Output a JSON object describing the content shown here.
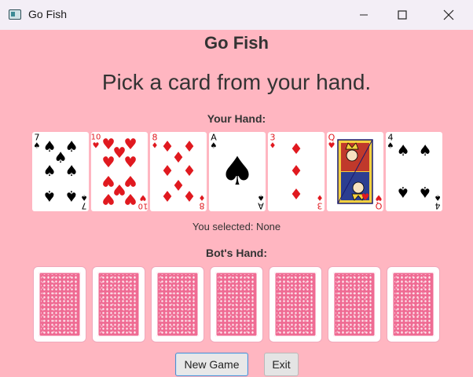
{
  "window": {
    "title": "Go Fish",
    "icon": "app-window-icon"
  },
  "game": {
    "title": "Go Fish",
    "prompt": "Pick a card from your hand.",
    "your_hand_label": "Your Hand:",
    "selected_text": "You selected: None",
    "bot_hand_label": "Bot's Hand:"
  },
  "player_hand": [
    {
      "rank": "7",
      "suit": "spades",
      "symbol": "♠",
      "color": "#000000"
    },
    {
      "rank": "10",
      "suit": "hearts",
      "symbol": "♥",
      "color": "#e0191f"
    },
    {
      "rank": "8",
      "suit": "diamonds",
      "symbol": "♦",
      "color": "#e0191f"
    },
    {
      "rank": "A",
      "suit": "spades",
      "symbol": "♠",
      "color": "#000000"
    },
    {
      "rank": "3",
      "suit": "diamonds",
      "symbol": "♦",
      "color": "#e0191f"
    },
    {
      "rank": "Q",
      "suit": "hearts",
      "symbol": "♥",
      "color": "#e0191f"
    },
    {
      "rank": "4",
      "suit": "spades",
      "symbol": "♠",
      "color": "#000000"
    }
  ],
  "bot_hand": {
    "count": 7,
    "back_color": "#ef6b93"
  },
  "buttons": {
    "new_game": "New Game",
    "exit": "Exit"
  },
  "colors": {
    "background": "#ffb6c1",
    "titlebar": "#f3eef6",
    "text": "#333333"
  }
}
